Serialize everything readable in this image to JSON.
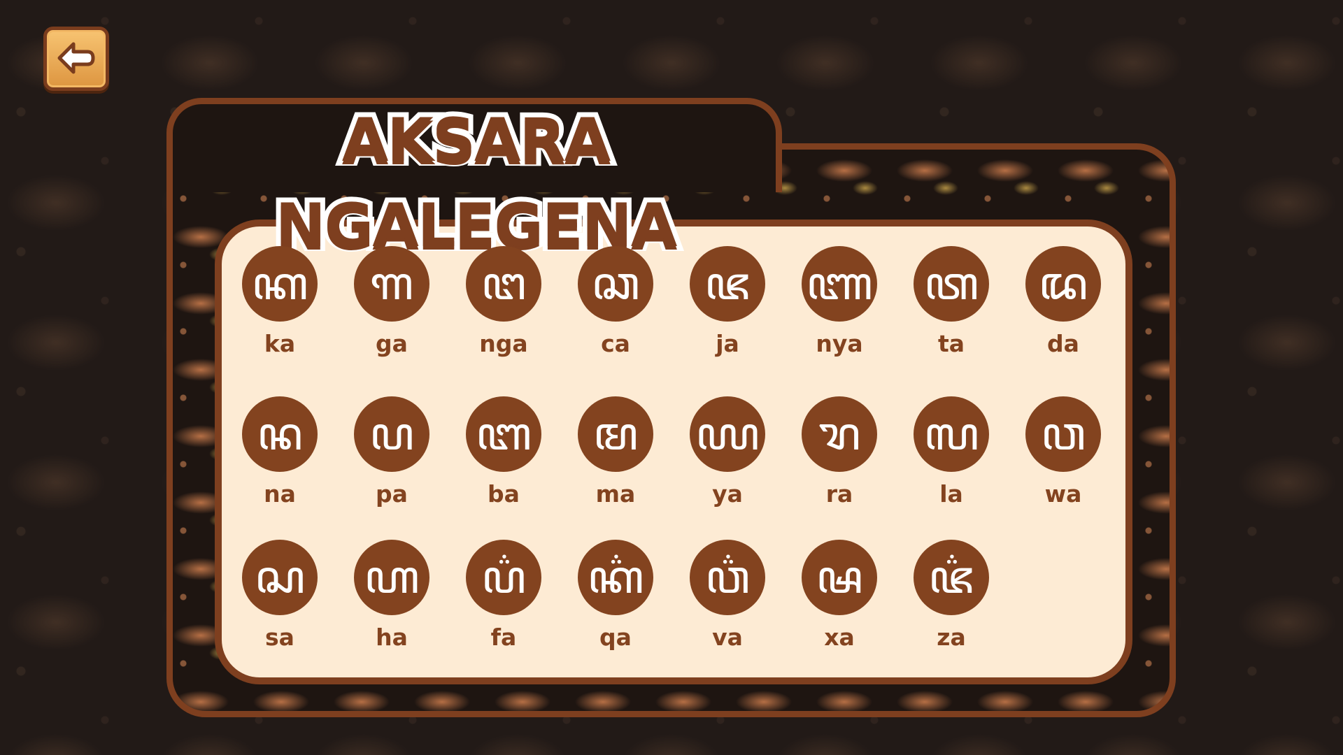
{
  "title": "AKSARA NGALEGENA",
  "icons": {
    "back": "arrow-left-icon"
  },
  "colors": {
    "brown": "#83431f",
    "cream": "#fdebd4",
    "back_button": "#f0b056"
  },
  "letters": [
    {
      "glyph": "ꦏ",
      "label": "ka"
    },
    {
      "glyph": "ꦒ",
      "label": "ga"
    },
    {
      "glyph": "ꦔ",
      "label": "nga"
    },
    {
      "glyph": "ꦕ",
      "label": "ca"
    },
    {
      "glyph": "ꦗ",
      "label": "ja"
    },
    {
      "glyph": "ꦚ",
      "label": "nya"
    },
    {
      "glyph": "ꦠ",
      "label": "ta"
    },
    {
      "glyph": "ꦢ",
      "label": "da"
    },
    {
      "glyph": "ꦤ",
      "label": "na"
    },
    {
      "glyph": "ꦥ",
      "label": "pa"
    },
    {
      "glyph": "ꦧ",
      "label": "ba"
    },
    {
      "glyph": "ꦩ",
      "label": "ma"
    },
    {
      "glyph": "ꦪ",
      "label": "ya"
    },
    {
      "glyph": "ꦫ",
      "label": "ra"
    },
    {
      "glyph": "ꦭ",
      "label": "la"
    },
    {
      "glyph": "ꦮ",
      "label": "wa"
    },
    {
      "glyph": "ꦱ",
      "label": "sa"
    },
    {
      "glyph": "ꦲ",
      "label": "ha"
    },
    {
      "glyph": "ꦥ꦳",
      "label": "fa"
    },
    {
      "glyph": "ꦏ꦳",
      "label": "qa"
    },
    {
      "glyph": "ꦮ꦳",
      "label": "va"
    },
    {
      "glyph": "ꦰ",
      "label": "xa"
    },
    {
      "glyph": "ꦗ꦳",
      "label": "za"
    }
  ]
}
